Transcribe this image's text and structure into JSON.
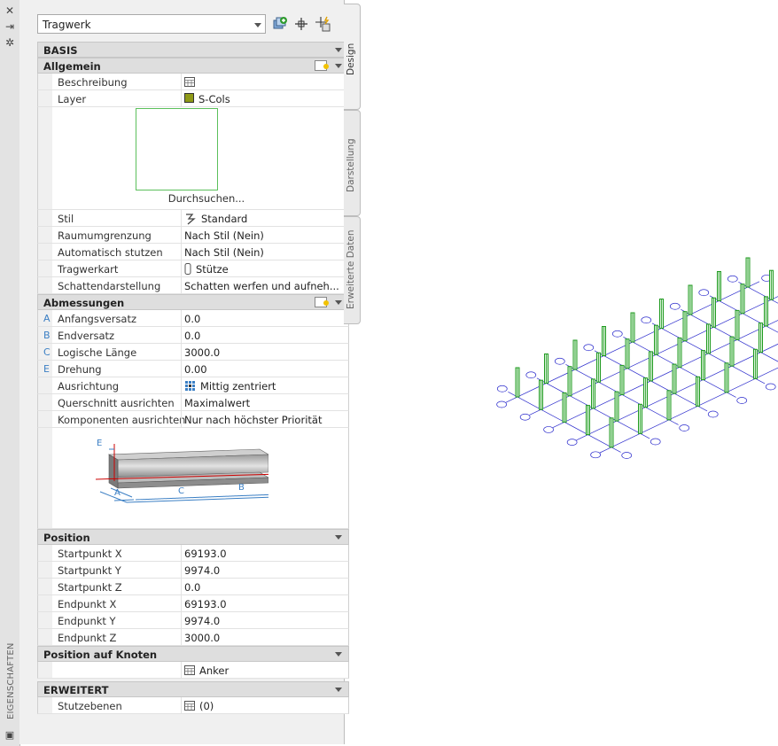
{
  "palette_title": "EIGENSCHAFTEN",
  "object_type": "Tragwerk",
  "side_tabs": [
    "Design",
    "Darstellung",
    "Erweiterte Daten"
  ],
  "sections": {
    "basis": "BASIS",
    "allgemein": "Allgemein",
    "abmessungen": "Abmessungen",
    "position": "Position",
    "position_knoten": "Position auf Knoten",
    "erweitert": "ERWEITERT"
  },
  "allgemein": {
    "beschreibung_label": "Beschreibung",
    "layer_label": "Layer",
    "layer_value": "S-Cols",
    "layer_color": "#8f9a17",
    "browse_label": "Durchsuchen...",
    "stil_label": "Stil",
    "stil_value": "Standard",
    "raum_label": "Raumumgrenzung",
    "raum_value": "Nach Stil (Nein)",
    "auto_label": "Automatisch stutzen",
    "auto_value": "Nach Stil (Nein)",
    "tragwerkart_label": "Tragwerkart",
    "tragwerkart_value": "Stütze",
    "schatten_label": "Schattendarstellung",
    "schatten_value": "Schatten werfen und aufneh..."
  },
  "abmessungen": {
    "anfang_letter": "A",
    "anfang_label": "Anfangsversatz",
    "anfang_value": "0.0",
    "end_letter": "B",
    "end_label": "Endversatz",
    "end_value": "0.0",
    "laenge_letter": "C",
    "laenge_label": "Logische Länge",
    "laenge_value": "3000.0",
    "dreh_letter": "E",
    "dreh_label": "Drehung",
    "dreh_value": "0.00",
    "ausr_label": "Ausrichtung",
    "ausr_value": "Mittig zentriert",
    "quer_label": "Querschnitt ausrichten",
    "quer_value": "Maximalwert",
    "komp_label": "Komponenten ausrichten",
    "komp_value": "Nur nach höchster Priorität",
    "diagram_letters": {
      "e": "E",
      "a": "A",
      "c": "C",
      "b": "B"
    }
  },
  "position": {
    "sx_label": "Startpunkt X",
    "sx_value": "69193.0",
    "sy_label": "Startpunkt Y",
    "sy_value": "9974.0",
    "sz_label": "Startpunkt Z",
    "sz_value": "0.0",
    "ex_label": "Endpunkt X",
    "ex_value": "69193.0",
    "ey_label": "Endpunkt Y",
    "ey_value": "9974.0",
    "ez_label": "Endpunkt Z",
    "ez_value": "3000.0"
  },
  "position_knoten": {
    "anker_value": "Anker"
  },
  "erweitert": {
    "stutz_label": "Stutzebenen",
    "stutz_value": "(0)"
  },
  "viewport": {
    "grid_color": "#2a2acc",
    "column_color": "#1f9a1f"
  }
}
